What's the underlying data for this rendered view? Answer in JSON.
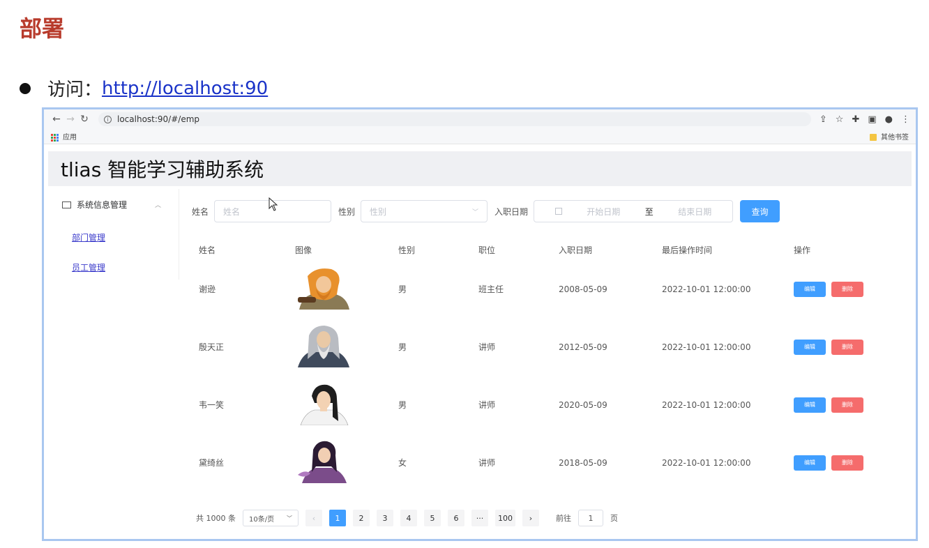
{
  "slide": {
    "title": "部署",
    "bullet_label": "访问：",
    "bullet_link": "http://localhost:90"
  },
  "browser": {
    "url": "localhost:90/#/emp",
    "bookmark_apps": "应用",
    "bookmark_other": "其他书签"
  },
  "app": {
    "title": "tlias 智能学习辅助系统"
  },
  "sidebar": {
    "group_label": "系统信息管理",
    "items": [
      {
        "label": "部门管理"
      },
      {
        "label": "员工管理"
      }
    ]
  },
  "search": {
    "name_label": "姓名",
    "name_placeholder": "姓名",
    "gender_label": "性别",
    "gender_placeholder": "性别",
    "date_label": "入职日期",
    "start_placeholder": "开始日期",
    "range_separator": "至",
    "end_placeholder": "结束日期",
    "query_button": "查询"
  },
  "table": {
    "headers": [
      "姓名",
      "图像",
      "性别",
      "职位",
      "入职日期",
      "最后操作时间",
      "操作"
    ],
    "edit_label": "编辑",
    "delete_label": "删除",
    "rows": [
      {
        "name": "谢逊",
        "gender": "男",
        "job": "班主任",
        "entry_date": "2008-05-09",
        "update_time": "2022-10-01 12:00:00"
      },
      {
        "name": "殷天正",
        "gender": "男",
        "job": "讲师",
        "entry_date": "2012-05-09",
        "update_time": "2022-10-01 12:00:00"
      },
      {
        "name": "韦一笑",
        "gender": "男",
        "job": "讲师",
        "entry_date": "2020-05-09",
        "update_time": "2022-10-01 12:00:00"
      },
      {
        "name": "黛绮丝",
        "gender": "女",
        "job": "讲师",
        "entry_date": "2018-05-09",
        "update_time": "2022-10-01 12:00:00"
      }
    ]
  },
  "pagination": {
    "total_text": "共 1000 条",
    "page_size": "10条/页",
    "prev": "‹",
    "pages": [
      "1",
      "2",
      "3",
      "4",
      "5",
      "6",
      "···",
      "100"
    ],
    "next": "›",
    "goto_prefix": "前往",
    "goto_value": "1",
    "goto_suffix": "页"
  },
  "colors": {
    "primary": "#409eff",
    "danger": "#f56c6c",
    "title_red": "#b83b2c"
  }
}
